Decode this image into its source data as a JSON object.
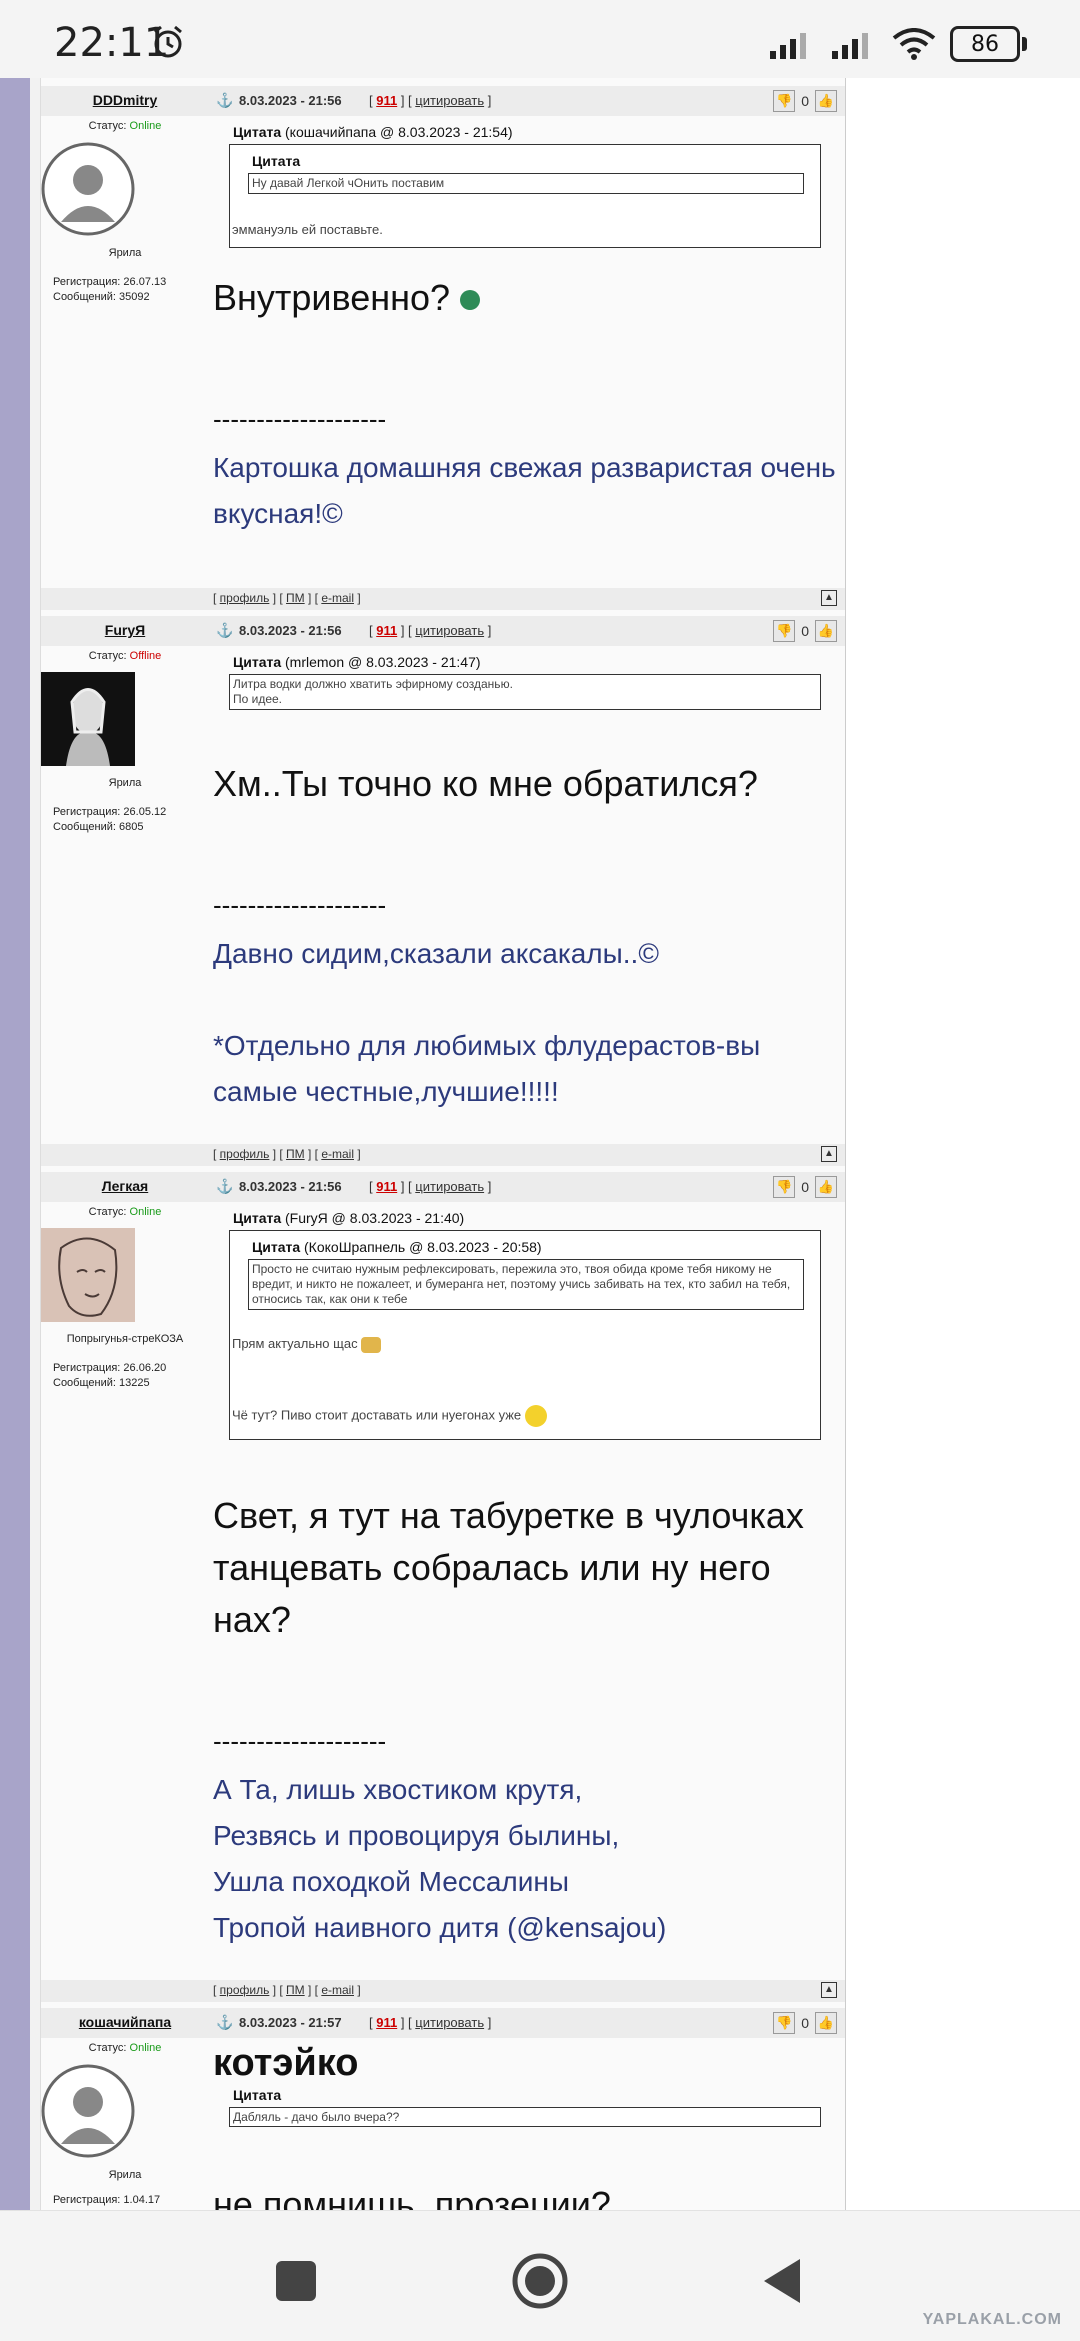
{
  "status_bar": {
    "time": "22:11",
    "battery": "86"
  },
  "posts": [
    {
      "author": "DDDmitry",
      "date": "8.03.2023 - 21:56",
      "post_num": "911",
      "cite_label": "цитировать",
      "rating": "0",
      "status_label": "Статус:",
      "status": "Online",
      "rank": "Ярила",
      "reg": "Регистрация: 26.07.13",
      "msgs": "Сообщений: 35092",
      "quote_title": "Цитата",
      "quote_meta": "(кошачийпапа @ 8.03.2023 - 21:54)",
      "inner_title": "Цитата",
      "inner_text": "Ну давай Легкой чОнить поставим",
      "quote_text": "эммануэль ей поставьте.",
      "message": "Внутривенно?",
      "sig_sep": "--------------------",
      "sig": "Картошка домашняя свежая разваристая очень вкусная!©"
    },
    {
      "author": "FuryЯ",
      "date": "8.03.2023 - 21:56",
      "post_num": "911",
      "cite_label": "цитировать",
      "rating": "0",
      "status_label": "Статус:",
      "status": "Offline",
      "rank": "Ярила",
      "reg": "Регистрация: 26.05.12",
      "msgs": "Сообщений: 6805",
      "quote_title": "Цитата",
      "quote_meta": "(mrlemon @ 8.03.2023 - 21:47)",
      "quote_text": "Литра водки должно хватить эфирному созданью.",
      "quote_text2": "По идее.",
      "message": "Хм..Ты точно ко мне обратился?",
      "sig_sep": "--------------------",
      "sig1": "Давно сидим,сказали аксакалы..©",
      "sig2": "*Отдельно для любимых флудерастов-вы самые честные,лучшие!!!!!"
    },
    {
      "author": "Легкая",
      "date": "8.03.2023 - 21:56",
      "post_num": "911",
      "cite_label": "цитировать",
      "rating": "0",
      "status_label": "Статус:",
      "status": "Online",
      "rank": "Попрыгунья-стреКОЗА",
      "reg": "Регистрация: 26.06.20",
      "msgs": "Сообщений: 13225",
      "quote_title": "Цитата",
      "quote_meta": "(FuryЯ @ 8.03.2023 - 21:40)",
      "inner_title": "Цитата",
      "inner_meta": "(КокоШрапнель @ 8.03.2023 - 20:58)",
      "inner_text": "Просто не считаю нужным рефлексировать, пережила это, твоя обида кроме тебя никому не вредит, и никто не пожалеет, и бумеранга нет, поэтому учись забивать на тех, кто забил на тебя, относись так, как они к тебе",
      "quote_text": "Прям актуально щас",
      "quote_text2": "Чё тут? Пиво стоит доставать или нуегонах уже",
      "message": "Свет, я тут на табуретке в чулочках танцевать собралась или ну него нах?",
      "sig_sep": "--------------------",
      "sig1": "А Та, лишь хвостиком крутя,",
      "sig2": "Резвясь и провоцируя былины,",
      "sig3": "Ушла походкой Мессалины",
      "sig4": "Тропой наивного дитя (@kensajou)"
    },
    {
      "author": "кошачийпапа",
      "date": "8.03.2023 - 21:57",
      "post_num": "911",
      "cite_label": "цитировать",
      "rating": "0",
      "status_label": "Статус:",
      "status": "Online",
      "rank": "Ярила",
      "reg": "Регистрация: 1.04.17",
      "message_title": "котэйко",
      "quote_title": "Цитата",
      "quote_text": "Дабляль - дачо было вчера??",
      "message": "не помнишь, прозеции?"
    }
  ],
  "footer_links": {
    "profile": "профиль",
    "pm": "ПМ",
    "email": "e-mail"
  },
  "watermark": "YAPLAKAL.COM"
}
